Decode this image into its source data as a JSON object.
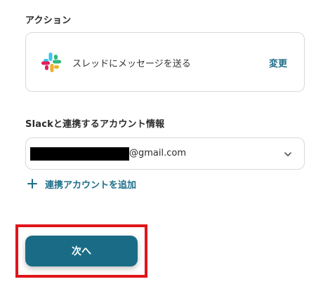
{
  "action_section": {
    "label": "アクション",
    "action_name": "スレッドにメッセージを送る",
    "change_label": "変更",
    "app_icon": "slack-logo-icon"
  },
  "account_section": {
    "label": "Slackと連携するアカウント情報",
    "selected_account_domain": "@gmail.com",
    "dropdown_icon": "chevron-down-icon",
    "add_account_label": "連携アカウントを追加",
    "add_icon": "plus-icon"
  },
  "footer": {
    "next_label": "次へ"
  },
  "colors": {
    "accent": "#1a6c86",
    "link": "#1f6f8b",
    "highlight": "#e0141b",
    "redaction": "#000000"
  }
}
